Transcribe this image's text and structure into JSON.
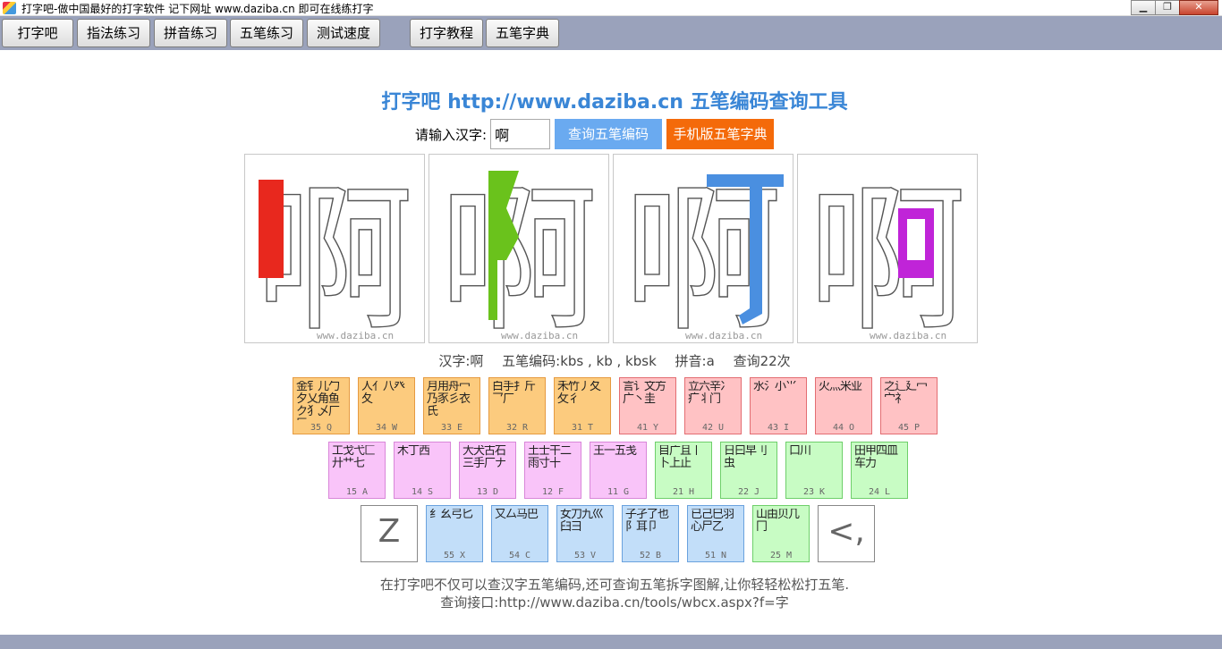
{
  "window": {
    "title": "打字吧-做中国最好的打字软件 记下网址 www.daziba.cn 即可在线练打字",
    "minimize": "▁",
    "restore": "❐",
    "close": "✕"
  },
  "toolbar": {
    "buttons": [
      "打字吧",
      "指法练习",
      "拼音练习",
      "五笔练习",
      "测试速度",
      "打字教程",
      "五笔字典"
    ]
  },
  "page": {
    "title": "打字吧 http://www.daziba.cn 五笔编码查询工具",
    "input_label": "请输入汉字:",
    "input_value": "啊",
    "query_button": "查询五笔编码",
    "mobile_button": "手机版五笔字典",
    "glyph": "啊",
    "watermark": "www.daziba.cn",
    "highlight_colors": [
      "#e8281e",
      "#6ac21c",
      "#4a8fe0",
      "#c024d8"
    ],
    "result": {
      "char": "汉字:啊",
      "codes": "五笔编码:kbs , kb , kbsk",
      "pinyin": "拼音:a",
      "count": "查询22次"
    },
    "footer": {
      "line1": "在打字吧不仅可以查汉字五笔编码,还可查询五笔拆字图解,让你轻轻松松打五笔.",
      "line2": "查询接口:http://www.daziba.cn/tools/wbcx.aspx?f=字"
    }
  },
  "keyboard": {
    "row1": [
      {
        "roots": "金钅儿勹夕乂角鱼ク犭乄厂匚",
        "code": "35 Q",
        "color": "orange"
      },
      {
        "roots": "人亻八癶夂",
        "code": "34 W",
        "color": "orange"
      },
      {
        "roots": "月用舟冖乃豕彡衣氏",
        "code": "33 E",
        "color": "orange"
      },
      {
        "roots": "白手扌斤乛厂",
        "code": "32 R",
        "color": "orange"
      },
      {
        "roots": "禾竹丿夂攵彳",
        "code": "31 T",
        "color": "orange"
      },
      {
        "roots": "言讠文方广丶圭",
        "code": "41 Y",
        "color": "red"
      },
      {
        "roots": "立六辛冫疒丬门",
        "code": "42 U",
        "color": "red"
      },
      {
        "roots": "水氵小⺌",
        "code": "43 I",
        "color": "red"
      },
      {
        "roots": "火灬米业",
        "code": "44 O",
        "color": "red"
      },
      {
        "roots": "之辶廴冖宀礻",
        "code": "45 P",
        "color": "red"
      }
    ],
    "row2": [
      {
        "roots": "工戈弋匚廾艹七",
        "code": "15 A",
        "color": "pink"
      },
      {
        "roots": "木丁西",
        "code": "14 S",
        "color": "pink"
      },
      {
        "roots": "大犬古石三手厂ナ",
        "code": "13 D",
        "color": "pink"
      },
      {
        "roots": "土士干二雨寸十",
        "code": "12 F",
        "color": "pink"
      },
      {
        "roots": "王一五戋",
        "code": "11 G",
        "color": "pink"
      },
      {
        "roots": "目广且丨卜上止",
        "code": "21 H",
        "color": "green"
      },
      {
        "roots": "日曰早刂虫",
        "code": "22 J",
        "color": "green"
      },
      {
        "roots": "口川",
        "code": "23 K",
        "color": "green"
      },
      {
        "roots": "田甲四皿车力",
        "code": "24 L",
        "color": "green"
      }
    ],
    "row3": [
      {
        "big": "Z",
        "color": "plain"
      },
      {
        "roots": "纟幺弓匕",
        "code": "55 X",
        "color": "blue"
      },
      {
        "roots": "又厶马巴",
        "code": "54 C",
        "color": "blue"
      },
      {
        "roots": "女刀九巛臼彐",
        "code": "53 V",
        "color": "blue"
      },
      {
        "roots": "子孑了也阝耳卩",
        "code": "52 B",
        "color": "blue"
      },
      {
        "roots": "已己巳羽心尸乙",
        "code": "51 N",
        "color": "blue"
      },
      {
        "roots": "山由贝几冂",
        "code": "25 M",
        "color": "green"
      },
      {
        "big": "<,",
        "color": "plain"
      }
    ]
  }
}
